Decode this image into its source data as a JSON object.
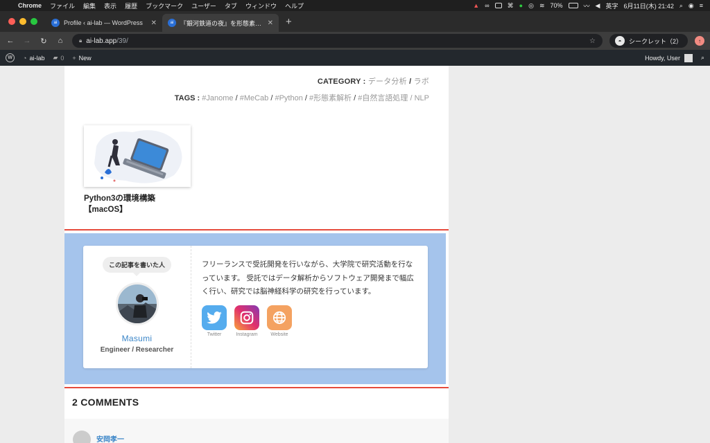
{
  "menubar": {
    "app": "Chrome",
    "menus": [
      "ファイル",
      "編集",
      "表示",
      "履歴",
      "ブックマーク",
      "ユーザー",
      "タブ",
      "ウィンドウ",
      "ヘルプ"
    ],
    "battery": "70%",
    "input": "英字",
    "datetime": "6月11日(木)  21:42"
  },
  "tabs": [
    {
      "title": "Profile ‹ ai-lab — WordPress",
      "favicon": "ai"
    },
    {
      "title": "『銀河鉄道の夜』を形態素解析してみた",
      "favicon": "ai"
    }
  ],
  "address": {
    "host": "ai-lab.app",
    "path": "/39/",
    "incognito": "シークレット（2）"
  },
  "wpbar": {
    "site": "ai-lab",
    "comments": "0",
    "new": "New",
    "howdy": "Howdy, User"
  },
  "post": {
    "category_label": "CATEGORY :",
    "categories": [
      "データ分析",
      "ラボ"
    ],
    "tags_label": "TAGS :",
    "tags": [
      "#Janome",
      "#MeCab",
      "#Python",
      "#形態素解析",
      "#自然言語処理",
      "NLP"
    ],
    "related_title_1": "Python3の環境構築",
    "related_title_2": "【macOS】"
  },
  "author": {
    "bubble": "この記事を書いた人",
    "name": "Masumi",
    "role": "Engineer / Researcher",
    "bio": "フリーランスで受託開発を行いながら、大学院で研究活動を行なっています。 受託ではデータ解析からソフトウェア開発まで幅広く行い、研究では脳神経科学の研究を行っています。",
    "social": [
      {
        "label": "Twitter",
        "color": "#55acee"
      },
      {
        "label": "Instagram",
        "color": "#c13584"
      },
      {
        "label": "Website",
        "color": "#f4a261"
      }
    ]
  },
  "comments": {
    "heading": "2 COMMENTS",
    "first_author": "安岡孝一"
  }
}
